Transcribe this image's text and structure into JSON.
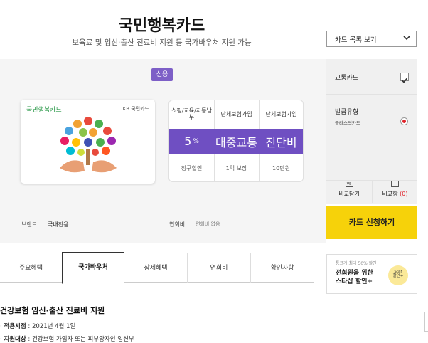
{
  "header": {
    "title": "국민행복카드",
    "subtitle": "보육료 및 임신·출산 진료비 지원 등 국가바우처 지원 가능"
  },
  "card_list_dropdown": {
    "label": "카드 목록 보기"
  },
  "card": {
    "type_badge": "신용",
    "logo_text": "국민행복카드",
    "issuer_text": "KB 국민카드",
    "accent_color": "#7d5fc7"
  },
  "benefits": [
    {
      "header": "쇼핑/교육/자동납부",
      "value": "5",
      "unit": "%",
      "footer": "청구할인"
    },
    {
      "header": "단체보험가입",
      "value": "대중교통",
      "unit": "",
      "footer": "1억 보장"
    },
    {
      "header": "단체보험가입",
      "value": "진단비",
      "unit": "",
      "footer": "10만원"
    }
  ],
  "side_options": {
    "transport": {
      "label": "교통카드",
      "checked": true
    },
    "issue_type": {
      "label": "발급유형",
      "value": "플라스틱카드",
      "selected": true
    },
    "compare_add": {
      "label": "비교담기",
      "icon": "vs-icon"
    },
    "compare_count": {
      "label": "비교함",
      "count": "(0)",
      "icon": "plus-box-icon"
    }
  },
  "brand_row": {
    "brand_key": "브랜드",
    "brand_value": "국내전용",
    "fee_key": "연회비",
    "fee_value": "연회비 없음"
  },
  "apply_button": {
    "label": "카드 신청하기",
    "color": "#f6d20a"
  },
  "tabs": [
    {
      "label": "주요혜택",
      "active": false
    },
    {
      "label": "국가바우처",
      "active": true
    },
    {
      "label": "상세혜택",
      "active": false
    },
    {
      "label": "연회비",
      "active": false
    },
    {
      "label": "확인사항",
      "active": false
    }
  ],
  "promo": {
    "top_text": "통크게 최대 50% 할인",
    "main_line1": "전회원을 위한",
    "main_line2": "스타샵 할인+",
    "badge_line1": "Star",
    "badge_line2": "할인+"
  },
  "section": {
    "title": "건강보험 임신·출산 진료비 지원",
    "details": [
      {
        "key": "적용시점",
        "value": "2021년 4월 1일"
      },
      {
        "key": "지원대상",
        "value": "건강보험 가입자 또는 피부양자인 임신부"
      }
    ]
  }
}
